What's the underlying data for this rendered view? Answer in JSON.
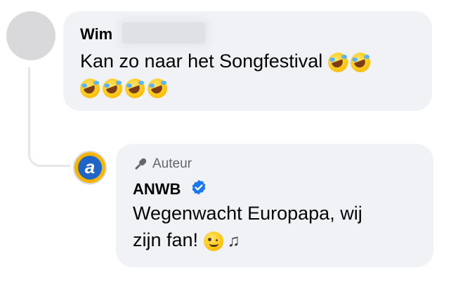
{
  "wim_comment": {
    "author": "Wim",
    "text": "Kan zo naar het Songfestival"
  },
  "anwb_comment": {
    "badge": "Auteur",
    "author": "ANWB",
    "line1": "Wegenwacht Europapa, wij",
    "line2": "zijn fan!",
    "avatar_letter": "a"
  },
  "colors": {
    "bubble": "#f0f2f5",
    "verified": "#1877f2",
    "anwb_blue": "#1f64c9",
    "anwb_yellow": "#f7b500"
  },
  "icons": [
    "rolling-on-floor-laughing-emoji",
    "winking-face-emoji",
    "musical-notes-emoji",
    "microphone-icon",
    "verified-badge-icon"
  ]
}
